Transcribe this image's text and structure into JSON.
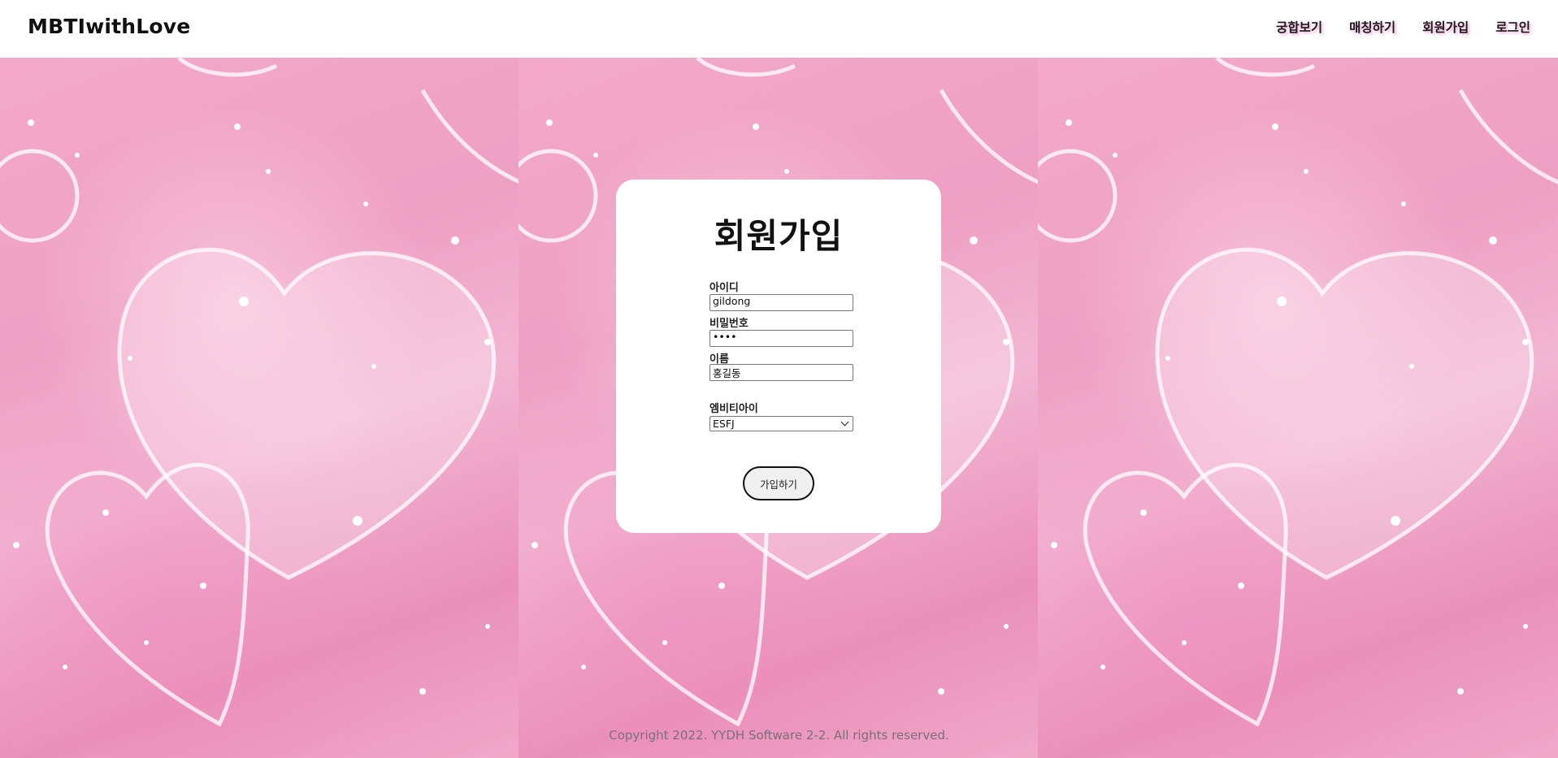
{
  "header": {
    "brand": "MBTIwithLove",
    "nav": [
      "궁합보기",
      "매칭하기",
      "회원가입",
      "로그인"
    ]
  },
  "form": {
    "title": "회원가입",
    "id_label": "아이디",
    "id_value": "gildong",
    "password_label": "비밀번호",
    "password_value": "••••",
    "name_label": "이름",
    "name_value": "홍길동",
    "mbti_label": "엠비티아이",
    "mbti_value": "ESFJ",
    "submit_label": "가입하기"
  },
  "footer": {
    "copyright": "Copyright 2022. YYDH Software 2-2. All rights reserved."
  },
  "colors": {
    "background_pink": "#f3a9c9",
    "nav_shadow": "#de50aa",
    "card": "#ffffff"
  }
}
